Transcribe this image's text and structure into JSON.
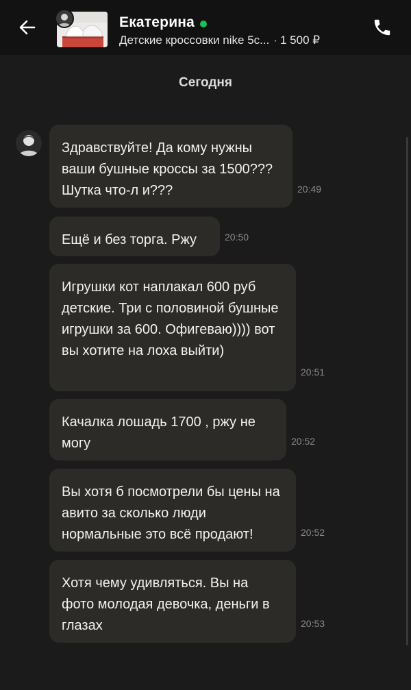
{
  "header": {
    "contact_name": "Екатерина",
    "online_color": "#17c357",
    "item_title": "Детские кроссовки nike 5с...",
    "item_separator": "·",
    "item_price": "1 500 ₽",
    "back_icon": "arrow-left-icon",
    "call_icon": "phone-icon"
  },
  "date_separator": "Сегодня",
  "messages": [
    {
      "text": "Здравствуйте! Да кому нужны ваши бушные кроссы за 1500??? Шутка что-л и???",
      "time": "20:49"
    },
    {
      "text": "Ещё и без торга. Ржу",
      "time": "20:50"
    },
    {
      "text": "Игрушки кот наплакал 600 руб детские. Три с половиной бушные игрушки за 600. Офигеваю)))) вот вы хотите на лоха выйти)",
      "time": "20:51"
    },
    {
      "text": "Качалка лошадь 1700 , ржу не могу",
      "time": "20:52"
    },
    {
      "text": "Вы хотя б посмотрели бы цены на авито за сколько люди нормальные это всё продают!",
      "time": "20:52"
    },
    {
      "text": "Хотя чему удивляться. Вы на фото молодая девочка, деньги в глазах",
      "time": "20:53"
    }
  ]
}
